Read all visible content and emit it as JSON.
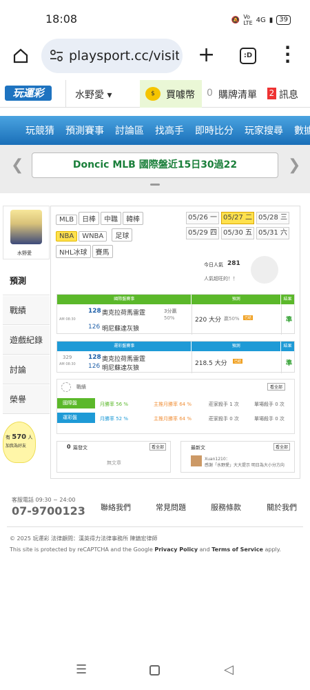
{
  "status": {
    "time": "18:08",
    "battery": "39",
    "signal": "4G"
  },
  "browser": {
    "url": "playsport.cc/visit",
    "tabs_count": ":D"
  },
  "header": {
    "logo": "玩運彩",
    "user": "水野愛",
    "coin_label": "買噱幣",
    "cart_count": "0",
    "cart_label": "購牌清單",
    "msg_count": "2",
    "msg_label": "訊息"
  },
  "nav": [
    "玩競猜",
    "預測賽事",
    "討論區",
    "找高手",
    "即時比分",
    "玩家搜尋",
    "數據"
  ],
  "ticker": {
    "name": "Doncic",
    "text": "MLB 國際盤近15日30過22"
  },
  "sidebar": {
    "username": "水野愛",
    "items": [
      "預測",
      "戰績",
      "遊戲紀錄",
      "討論",
      "榮譽"
    ],
    "fans_prefix": "有",
    "fans_count": "570",
    "fans_suffix": "人",
    "fans_tail": "加我為好友"
  },
  "leagues": [
    "MLB",
    "日棒",
    "中職",
    "韓棒",
    "NBA",
    "WNBA",
    "足球",
    "NHL冰球",
    "賽馬"
  ],
  "active_league": "NBA",
  "dates": [
    "05/26 一",
    "05/27 二",
    "05/28 三",
    "05/29 四",
    "05/30 五",
    "05/31 六"
  ],
  "active_date": "05/27 二",
  "popularity": {
    "label": "今日人氣",
    "value": "281",
    "sub": "人氣超旺的！！"
  },
  "intl": {
    "header": "國際盤賽事",
    "pred_header": "預測",
    "result_header": "結果",
    "time": "AM 08:30",
    "home_no": "128",
    "home": "奧克拉荷馬雷霆",
    "away_no": "126",
    "away": "明尼蘇達灰狼",
    "spread": "3分贏",
    "spread_pct": "50%",
    "pick": "220 大分",
    "pick_detail": "贏50%",
    "badge": "已結",
    "result": "準"
  },
  "tw": {
    "header": "運彩盤賽事",
    "pred_header": "預測",
    "result_header": "結果",
    "game_no": "329",
    "time": "AM 08:30",
    "home_no": "128",
    "home": "奧克拉荷馬雷霆",
    "away_no": "126",
    "away": "明尼蘇達灰狼",
    "pick": "218.5 大分",
    "badge": "已結",
    "result": "準"
  },
  "record": {
    "title": "戰績",
    "more": "看全部",
    "intl_label": "國際盤",
    "intl_rate": "月勝率 56 %",
    "intl_kill": "主推月勝率 64 %",
    "intl_star": "莊家殺手 1 次",
    "intl_single": "單場殺手 0 次",
    "tw_label": "運彩盤",
    "tw_rate": "月勝率 52 %",
    "tw_kill": "主推月勝率 64 %",
    "tw_star": "莊家殺手 0 次",
    "tw_single": "單場殺手 0 次",
    "intl_rate_value": 56,
    "tw_rate_value": 52
  },
  "posts": {
    "count": "0",
    "title": "篇發文",
    "more": "看全部",
    "empty": "無文章",
    "reply_title": "最新文",
    "reply_more": "看全部",
    "reply_user": "Xuan1210：",
    "reply_text": "感謝「水野愛」大大提示 明日為大小分方向"
  },
  "footer": {
    "service_label": "客服電話 09:30 ~ 24:00",
    "phone": "07-9700123",
    "links": [
      "聯絡我們",
      "常見問題",
      "服務條款",
      "關於我們"
    ],
    "copyright": "© 2025 玩運彩  法律顧問：漢英得力法律事務所 陳鎮宏律師",
    "recaptcha": "This site is protected by reCAPTCHA and the Google",
    "privacy": "Privacy Policy",
    "and": "and",
    "terms": "Terms of Service",
    "apply": "apply."
  }
}
